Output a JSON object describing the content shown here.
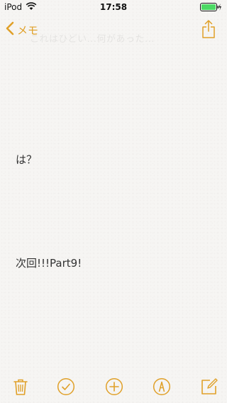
{
  "status_bar": {
    "carrier": "iPod",
    "time": "17:58",
    "wifi_icon": "wifi-icon",
    "battery_icon": "battery-charging-icon",
    "battery_color": "#4cd964"
  },
  "nav": {
    "back_label": "メモ",
    "back_icon": "chevron-left-icon",
    "share_icon": "share-icon",
    "accent_color": "#e0a028"
  },
  "note": {
    "faded_title": "これはひどい...何があった...",
    "lines": [
      "は？",
      "次回!!!Part9!"
    ]
  },
  "toolbar": {
    "items": [
      "trash-icon",
      "checklist-icon",
      "add-icon",
      "markup-icon",
      "compose-icon"
    ]
  }
}
